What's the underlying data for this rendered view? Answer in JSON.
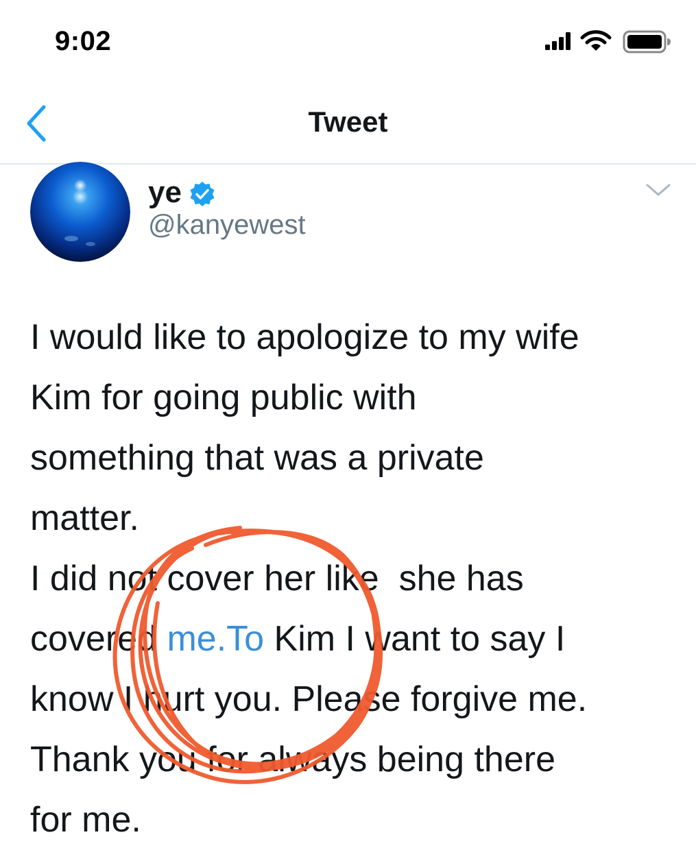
{
  "status_bar": {
    "time": "9:02"
  },
  "nav": {
    "title": "Tweet"
  },
  "tweet": {
    "display_name": "ye",
    "handle": "@kanyewest",
    "lines": [
      {
        "before": "I would like to apologize to my wife",
        "link": "",
        "after": ""
      },
      {
        "before": "Kim for going public with",
        "link": "",
        "after": ""
      },
      {
        "before": "something that was a private",
        "link": "",
        "after": ""
      },
      {
        "before": "matter.",
        "link": "",
        "after": ""
      },
      {
        "before": "I did not cover her like  she has",
        "link": "",
        "after": ""
      },
      {
        "before": "covered ",
        "link": "me.To",
        "after": " Kim I want to say I"
      },
      {
        "before": "know I hurt you. Please forgive me.",
        "link": "",
        "after": ""
      },
      {
        "before": "Thank you for always being there",
        "link": "",
        "after": ""
      },
      {
        "before": "for me.",
        "link": "",
        "after": ""
      }
    ]
  },
  "colors": {
    "link": "#3a8fd9",
    "accent": "#1da1f2",
    "annotation": "#f05a2e"
  },
  "icons": {
    "back": "chevron-left-icon",
    "verified": "verified-badge-icon",
    "more": "chevron-down-icon"
  }
}
